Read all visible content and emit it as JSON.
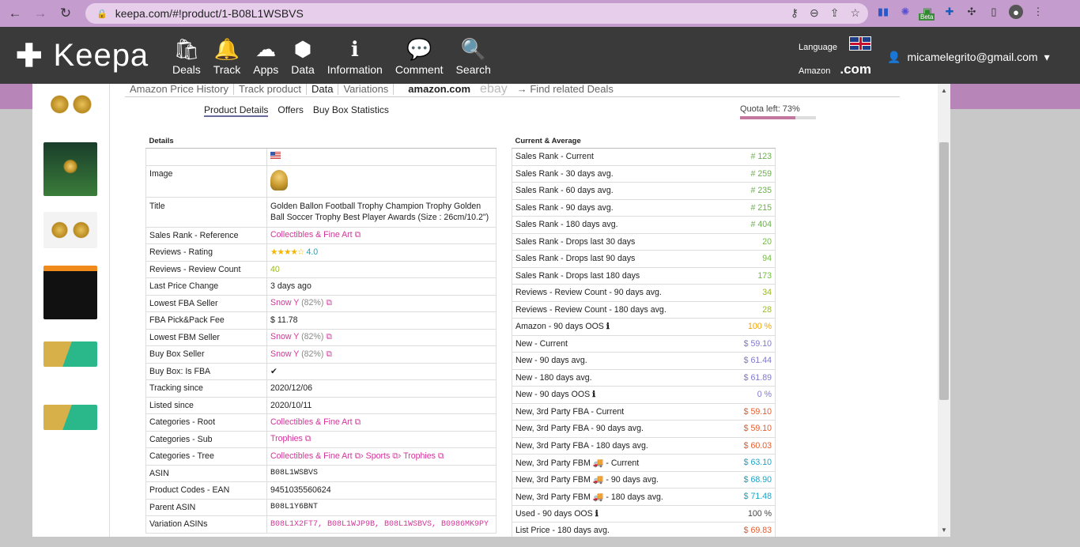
{
  "browser": {
    "url": "keepa.com/#!product/1-B08L1WSBVS",
    "beta_badge": "Beta"
  },
  "keepa": {
    "brand": "Keepa",
    "menu": [
      {
        "label": "Deals",
        "icon": "shopping-bag-icon",
        "glyph": "🛍"
      },
      {
        "label": "Track",
        "icon": "bell-icon",
        "glyph": "🔔"
      },
      {
        "label": "Apps",
        "icon": "cloud-download-icon",
        "glyph": "☁"
      },
      {
        "label": "Data",
        "icon": "cube-icon",
        "glyph": "⬢"
      },
      {
        "label": "Information",
        "icon": "info-icon",
        "glyph": "ℹ"
      },
      {
        "label": "Comment",
        "icon": "chat-icon",
        "glyph": "💬"
      },
      {
        "label": "Search",
        "icon": "search-icon",
        "glyph": "🔍"
      }
    ],
    "language_label": "Language",
    "amazon_label": "Amazon",
    "domain": ".com",
    "user_email": "micamelegrito@gmail.com"
  },
  "tabs": {
    "items": [
      "Amazon Price History",
      "Track product",
      "Data",
      "Variations"
    ],
    "active": "Data",
    "amazon_logo": "amazon.com",
    "ebay_logo": "ebay",
    "related": "→ Find related Deals"
  },
  "subtabs": {
    "items": [
      "Product Details",
      "Offers",
      "Buy Box Statistics"
    ],
    "active": "Product Details"
  },
  "quota": {
    "label": "Quota left: 73%",
    "percent": 73
  },
  "details": {
    "header": "Details",
    "rows": [
      {
        "k": "",
        "v": ""
      },
      {
        "k": "Image",
        "v": ""
      },
      {
        "k": "Title",
        "v": "Golden Ballon Football Trophy Champion Trophy Golden Ball Soccer Trophy Best Player Awards (Size : 26cm/10.2\")"
      },
      {
        "k": "Sales Rank - Reference",
        "v": "Collectibles & Fine Art"
      },
      {
        "k": "Reviews - Rating",
        "v": "4.0"
      },
      {
        "k": "Reviews - Review Count",
        "v": "40"
      },
      {
        "k": "Last Price Change",
        "v": "3 days ago"
      },
      {
        "k": "Lowest FBA Seller",
        "v": "Snow Y",
        "extra": "(82%)"
      },
      {
        "k": "FBA Pick&Pack Fee",
        "v": "$ 11.78"
      },
      {
        "k": "Lowest FBM Seller",
        "v": "Snow Y",
        "extra": "(82%)"
      },
      {
        "k": "Buy Box Seller",
        "v": "Snow Y",
        "extra": "(82%)"
      },
      {
        "k": "Buy Box: Is FBA",
        "v": "✔"
      },
      {
        "k": "Tracking since",
        "v": "2020/12/06"
      },
      {
        "k": "Listed since",
        "v": "2020/10/11"
      },
      {
        "k": "Categories - Root",
        "v": "Collectibles & Fine Art"
      },
      {
        "k": "Categories - Sub",
        "v": "Trophies"
      },
      {
        "k": "Categories - Tree",
        "v": "Collectibles & Fine Art",
        "v2": "Sports",
        "v3": "Trophies"
      },
      {
        "k": "ASIN",
        "v": "B08L1WSBVS"
      },
      {
        "k": "Product Codes - EAN",
        "v": "9451035560624"
      },
      {
        "k": "Parent ASIN",
        "v": "B08L1Y6BNT"
      },
      {
        "k": "Variation ASINs",
        "v": "B08L1X2FT7, B08L1WJP9B, B08L1WSBVS, B0986MK9PY"
      }
    ]
  },
  "current": {
    "header": "Current & Average",
    "rows": [
      {
        "k": "Sales Rank - Current",
        "v": "# 123",
        "c": "green"
      },
      {
        "k": "Sales Rank - 30 days avg.",
        "v": "# 259",
        "c": "green"
      },
      {
        "k": "Sales Rank - 60 days avg.",
        "v": "# 235",
        "c": "green"
      },
      {
        "k": "Sales Rank - 90 days avg.",
        "v": "# 215",
        "c": "green"
      },
      {
        "k": "Sales Rank - 180 days avg.",
        "v": "# 404",
        "c": "green"
      },
      {
        "k": "Sales Rank - Drops last 30 days",
        "v": "20",
        "c": "green2"
      },
      {
        "k": "Sales Rank - Drops last 90 days",
        "v": "94",
        "c": "green2"
      },
      {
        "k": "Sales Rank - Drops last 180 days",
        "v": "173",
        "c": "green2"
      },
      {
        "k": "Reviews - Review Count - 90 days avg.",
        "v": "34",
        "c": "olive"
      },
      {
        "k": "Reviews - Review Count - 180 days avg.",
        "v": "28",
        "c": "olive"
      },
      {
        "k": "Amazon - 90 days OOS",
        "v": "100 %",
        "c": "orange",
        "info": true
      },
      {
        "k": "New - Current",
        "v": "$ 59.10",
        "c": "purple"
      },
      {
        "k": "New - 90 days avg.",
        "v": "$ 61.44",
        "c": "purple"
      },
      {
        "k": "New - 180 days avg.",
        "v": "$ 61.89",
        "c": "purple"
      },
      {
        "k": "New - 90 days OOS",
        "v": "0 %",
        "c": "blue2",
        "info": true
      },
      {
        "k": "New, 3rd Party FBA - Current",
        "v": "$ 59.10",
        "c": "redorange"
      },
      {
        "k": "New, 3rd Party FBA - 90 days avg.",
        "v": "$ 59.10",
        "c": "redorange"
      },
      {
        "k": "New, 3rd Party FBA - 180 days avg.",
        "v": "$ 60.03",
        "c": "redorange"
      },
      {
        "k": "New, 3rd Party FBM",
        "k2": "- Current",
        "v": "$ 63.10",
        "c": "cyan",
        "truck": true
      },
      {
        "k": "New, 3rd Party FBM",
        "k2": "- 90 days avg.",
        "v": "$ 68.90",
        "c": "cyan",
        "truck": true
      },
      {
        "k": "New, 3rd Party FBM",
        "k2": "- 180 days avg.",
        "v": "$ 71.48",
        "c": "cyan",
        "truck": true
      },
      {
        "k": "Used - 90 days OOS",
        "v": "100 %",
        "c": "dark",
        "info": true
      },
      {
        "k": "List Price - 180 days avg.",
        "v": "$ 69.83",
        "c": "redorange"
      }
    ]
  }
}
